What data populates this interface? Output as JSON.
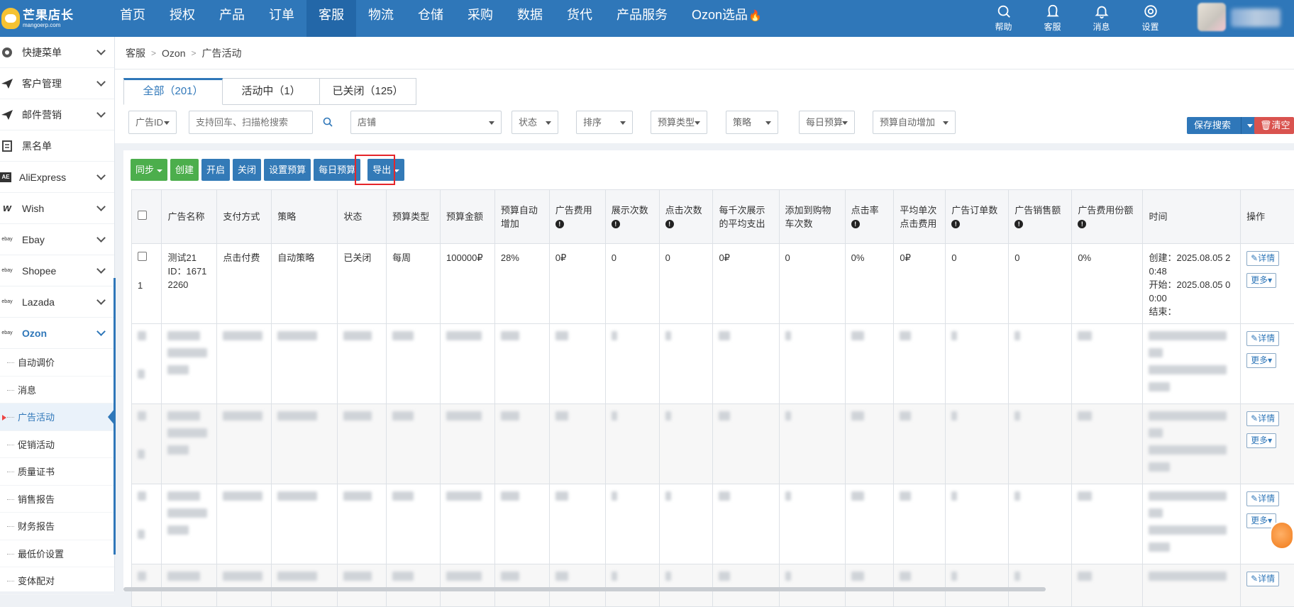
{
  "brand": {
    "name": "芒果店长",
    "domain": "mangoerp.com"
  },
  "nav": [
    "首页",
    "授权",
    "产品",
    "订单",
    "客服",
    "物流",
    "仓储",
    "采购",
    "数据",
    "货代",
    "产品服务",
    "Ozon选品"
  ],
  "nav_active": "客服",
  "tools": [
    {
      "label": "帮助",
      "icon": "help-icon"
    },
    {
      "label": "客服",
      "icon": "service-icon"
    },
    {
      "label": "消息",
      "icon": "bell-icon"
    },
    {
      "label": "设置",
      "icon": "gear-icon"
    }
  ],
  "sidebar": {
    "items": [
      {
        "label": "快捷菜单",
        "icon": "gear-icon",
        "chevron": true
      },
      {
        "label": "客户管理",
        "icon": "paper-plane-icon",
        "chevron": true
      },
      {
        "label": "邮件营销",
        "icon": "paper-plane-icon",
        "chevron": true
      },
      {
        "label": "黑名单",
        "icon": "list-icon",
        "chevron": false
      },
      {
        "label": "AliExpress",
        "icon": "aliexpress-icon",
        "chevron": true
      },
      {
        "label": "Wish",
        "icon": "wish-icon",
        "chevron": true
      },
      {
        "label": "Ebay",
        "icon": "ebay-icon",
        "chevron": true
      },
      {
        "label": "Shopee",
        "icon": "ebay-icon",
        "chevron": true
      },
      {
        "label": "Lazada",
        "icon": "ebay-icon",
        "chevron": true
      },
      {
        "label": "Ozon",
        "icon": "ebay-icon",
        "chevron": true
      }
    ],
    "icon_texts": {
      "ae": "AE",
      "w": "w",
      "ebay": "ebay"
    },
    "sub": [
      "自动调价",
      "消息",
      "广告活动",
      "促销活动",
      "质量证书",
      "销售报告",
      "财务报告",
      "最低价设置",
      "变体配对"
    ],
    "sub_active": "广告活动"
  },
  "breadcrumb": [
    "客服",
    "Ozon",
    "广告活动"
  ],
  "tabs": [
    {
      "label": "全部（201）",
      "active": true
    },
    {
      "label": "活动中（1）",
      "active": false
    },
    {
      "label": "已关闭（125）",
      "active": false
    }
  ],
  "filters": {
    "ad_id": "广告ID",
    "search_placeholder": "支持回车、扫描枪搜索",
    "store": "店铺",
    "status": "状态",
    "sort": "排序",
    "budget_type": "预算类型",
    "strategy": "策略",
    "daily_budget": "每日预算",
    "budget_auto": "预算自动增加"
  },
  "save_search": "保存搜索",
  "clear": "清空",
  "toolbar": [
    "同步",
    "创建",
    "开启",
    "关闭",
    "设置预算",
    "每日预算",
    "导出"
  ],
  "columns": [
    "广告名称",
    "支付方式",
    "策略",
    "状态",
    "预算类型",
    "预算金额",
    "预算自动增加",
    "广告费用",
    "展示次数",
    "点击次数",
    "每千次展示的平均支出",
    "添加到购物车次数",
    "点击率",
    "平均单次点击费用",
    "广告订单数",
    "广告销售额",
    "广告费用份额",
    "时间",
    "操作"
  ],
  "row1": {
    "index": "1",
    "name": "测试21",
    "id": "ID：16712260",
    "pay": "点击付费",
    "strategy": "自动策略",
    "status": "已关闭",
    "budget_type": "每周",
    "budget": "100000₽",
    "auto_inc": "28%",
    "cost": "0₽",
    "views": "0",
    "clicks": "0",
    "cpm": "0₽",
    "cart": "0",
    "ctr": "0%",
    "cpc": "0₽",
    "orders": "0",
    "sales": "0",
    "share": "0%",
    "created": "创建：2025.08.05 20:48",
    "start": "开始：2025.08.05 00:00",
    "end": "结束："
  },
  "op_detail": "详情",
  "op_more": "更多"
}
